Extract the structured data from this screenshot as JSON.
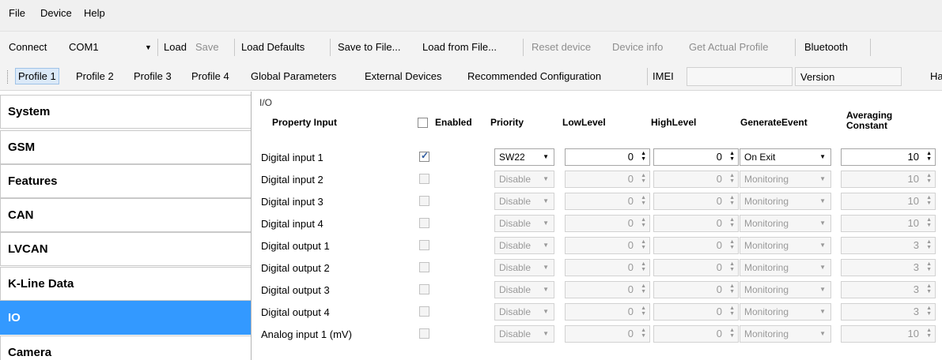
{
  "menu": [
    "File",
    "Device",
    "Help"
  ],
  "toolbar": {
    "connect_label": "Connect",
    "port_value": "COM1",
    "load": "Load",
    "save": "Save",
    "load_defaults": "Load Defaults",
    "save_to_file": "Save to File...",
    "load_from_file": "Load from File...",
    "reset_device": "Reset device",
    "device_info": "Device info",
    "get_actual_profile": "Get Actual Profile",
    "bluetooth": "Bluetooth"
  },
  "tabs": {
    "profile1": "Profile 1",
    "profile2": "Profile 2",
    "profile3": "Profile 3",
    "profile4": "Profile 4",
    "global_parameters": "Global Parameters",
    "external_devices": "External Devices",
    "recommended_configuration": "Recommended Configuration",
    "imei": "IMEI",
    "version": "Version",
    "ha": "Ha"
  },
  "sidebar": [
    "System",
    "GSM",
    "Features",
    "CAN",
    "LVCAN",
    "K-Line Data",
    "IO",
    "Camera"
  ],
  "io": {
    "section_label": "I/O",
    "headers": {
      "property_input": "Property Input",
      "enabled": "Enabled",
      "priority": "Priority",
      "low_level": "LowLevel",
      "high_level": "HighLevel",
      "generate_event": "GenerateEvent",
      "averaging_line1": "Averaging",
      "averaging_line2": "Constant"
    },
    "rows": [
      {
        "name": "Digital input 1",
        "priority": "SW22",
        "low": "0",
        "high": "0",
        "event": "On Exit",
        "avg": "10"
      },
      {
        "name": "Digital input 2",
        "priority": "Disable",
        "low": "0",
        "high": "0",
        "event": "Monitoring",
        "avg": "10"
      },
      {
        "name": "Digital input 3",
        "priority": "Disable",
        "low": "0",
        "high": "0",
        "event": "Monitoring",
        "avg": "10"
      },
      {
        "name": "Digital input 4",
        "priority": "Disable",
        "low": "0",
        "high": "0",
        "event": "Monitoring",
        "avg": "10"
      },
      {
        "name": "Digital output 1",
        "priority": "Disable",
        "low": "0",
        "high": "0",
        "event": "Monitoring",
        "avg": "3"
      },
      {
        "name": "Digital output 2",
        "priority": "Disable",
        "low": "0",
        "high": "0",
        "event": "Monitoring",
        "avg": "3"
      },
      {
        "name": "Digital output 3",
        "priority": "Disable",
        "low": "0",
        "high": "0",
        "event": "Monitoring",
        "avg": "3"
      },
      {
        "name": "Digital output 4",
        "priority": "Disable",
        "low": "0",
        "high": "0",
        "event": "Monitoring",
        "avg": "3"
      },
      {
        "name": "Analog input 1 (mV)",
        "priority": "Disable",
        "low": "0",
        "high": "0",
        "event": "Monitoring",
        "avg": "10"
      }
    ]
  },
  "colors": {
    "selection": "#3399ff",
    "active_tab": "#dbe9f8"
  }
}
